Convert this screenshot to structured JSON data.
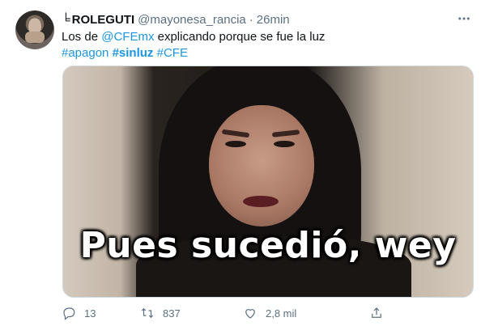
{
  "tweet": {
    "author": {
      "name": "ROLEGUTI",
      "handle": "@mayonesa_rancia",
      "separator": "·",
      "time": "26min",
      "name_prefix_glyph": "╘"
    },
    "text": {
      "line1_prefix": "Los de ",
      "mention": "@CFEmx",
      "line1_suffix": " explicando porque se fue la luz",
      "hashtags": [
        "#apagon",
        "#sinluz",
        "#CFE"
      ]
    },
    "media": {
      "caption": "Pues sucedió, wey"
    },
    "actions": {
      "replies": "13",
      "retweets": "837",
      "likes": "2,8 mil"
    },
    "icons": {
      "more": "more-icon",
      "reply": "reply-icon",
      "retweet": "retweet-icon",
      "like": "like-icon",
      "share": "share-icon"
    },
    "colors": {
      "link": "#1b95e0",
      "secondary": "#5b7083",
      "text": "#0f1419"
    }
  }
}
